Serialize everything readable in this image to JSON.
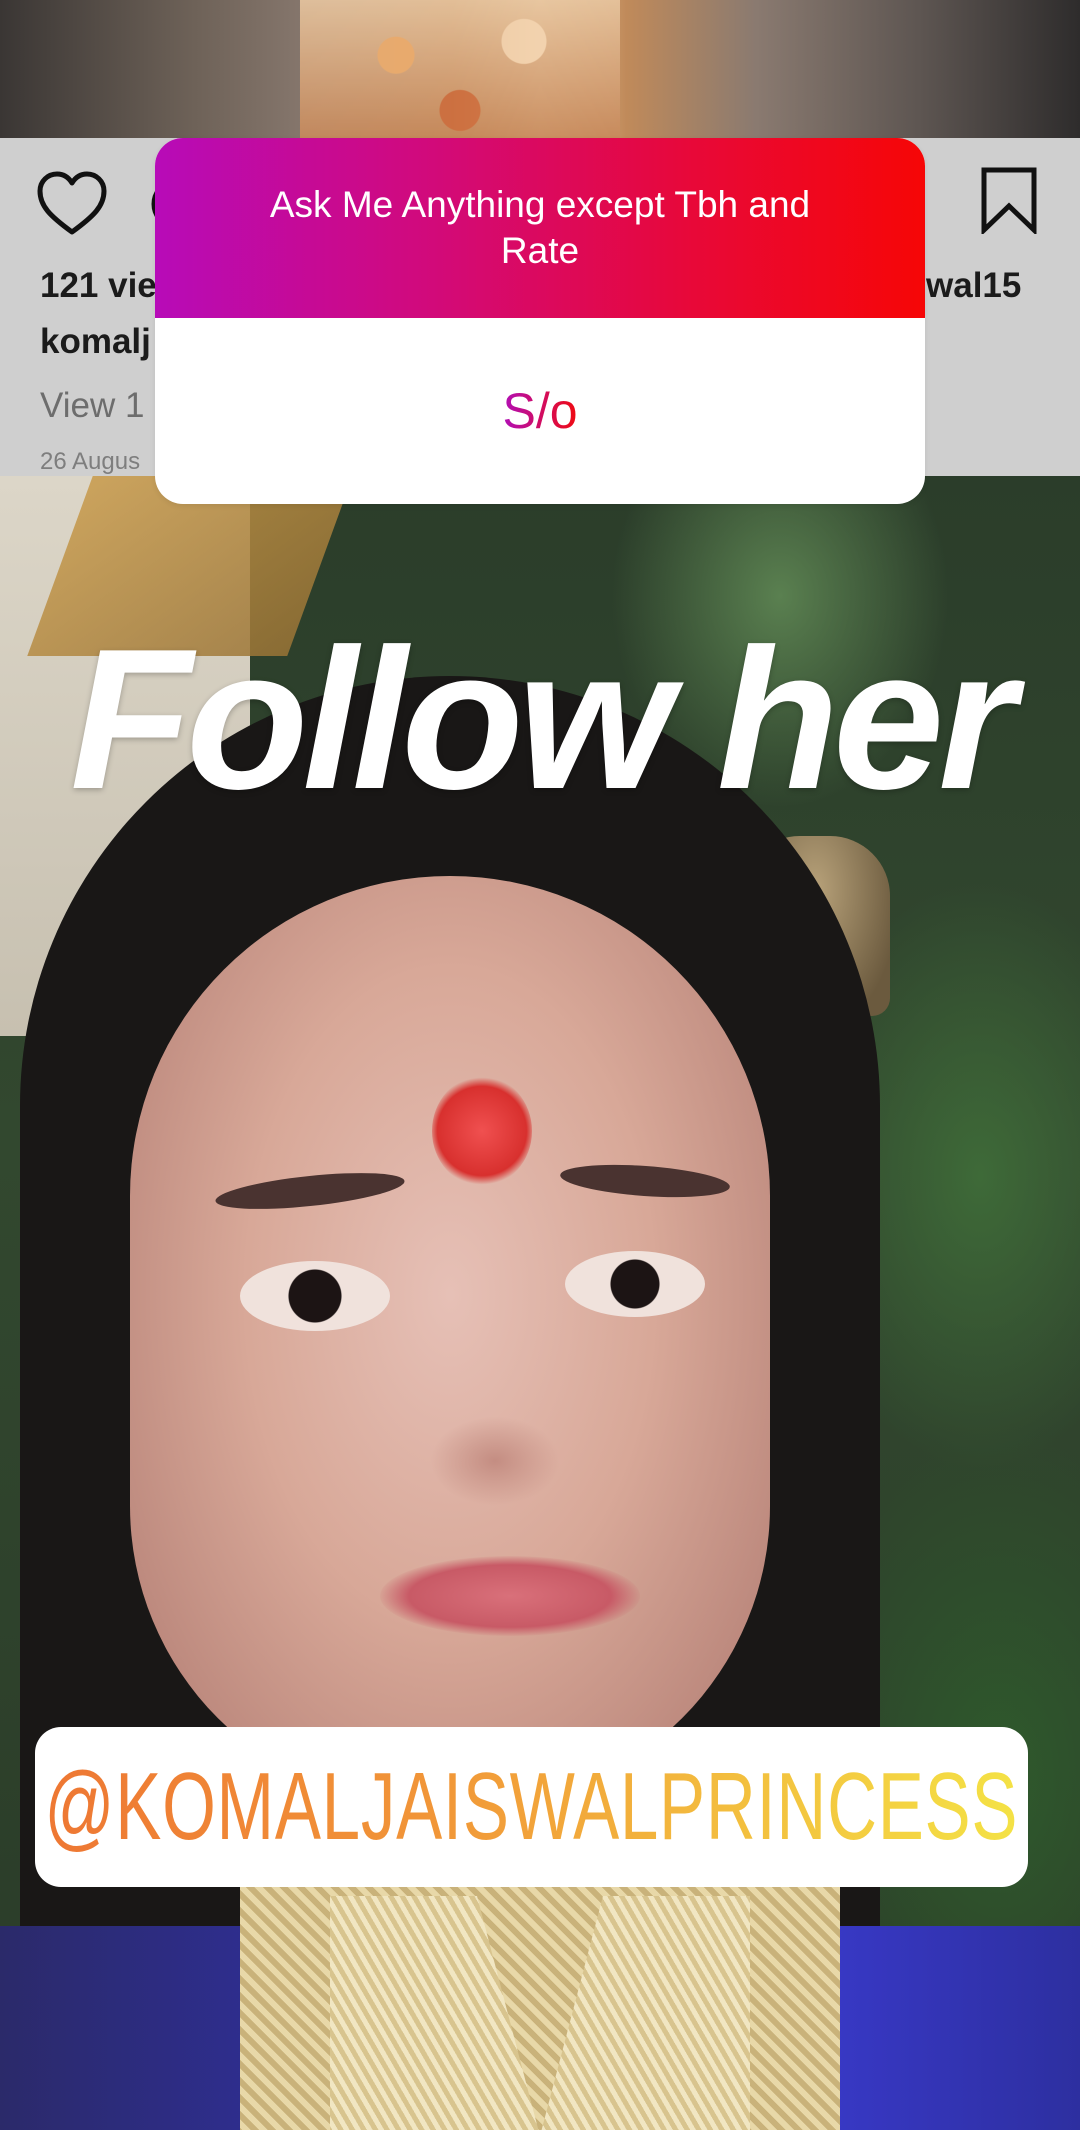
{
  "post": {
    "views": "121 vie",
    "username_partial": "wal15",
    "caption_user_partial": "komalj",
    "view_comments_partial": "View 1",
    "date_partial": "26 Augus"
  },
  "question_sticker": {
    "prompt": "Ask Me Anything except Tbh and Rate",
    "answer": "S/o",
    "gradient_start": "#b70bb8",
    "gradient_end": "#f60606"
  },
  "story": {
    "headline": "Follow her",
    "mention": "@KOMALJAISWALPRINCESS",
    "mention_gradient": [
      "#ee7733",
      "#f4e245"
    ]
  },
  "icons": {
    "like": "heart-outline-icon",
    "comment": "comment-icon",
    "save": "bookmark-icon"
  }
}
